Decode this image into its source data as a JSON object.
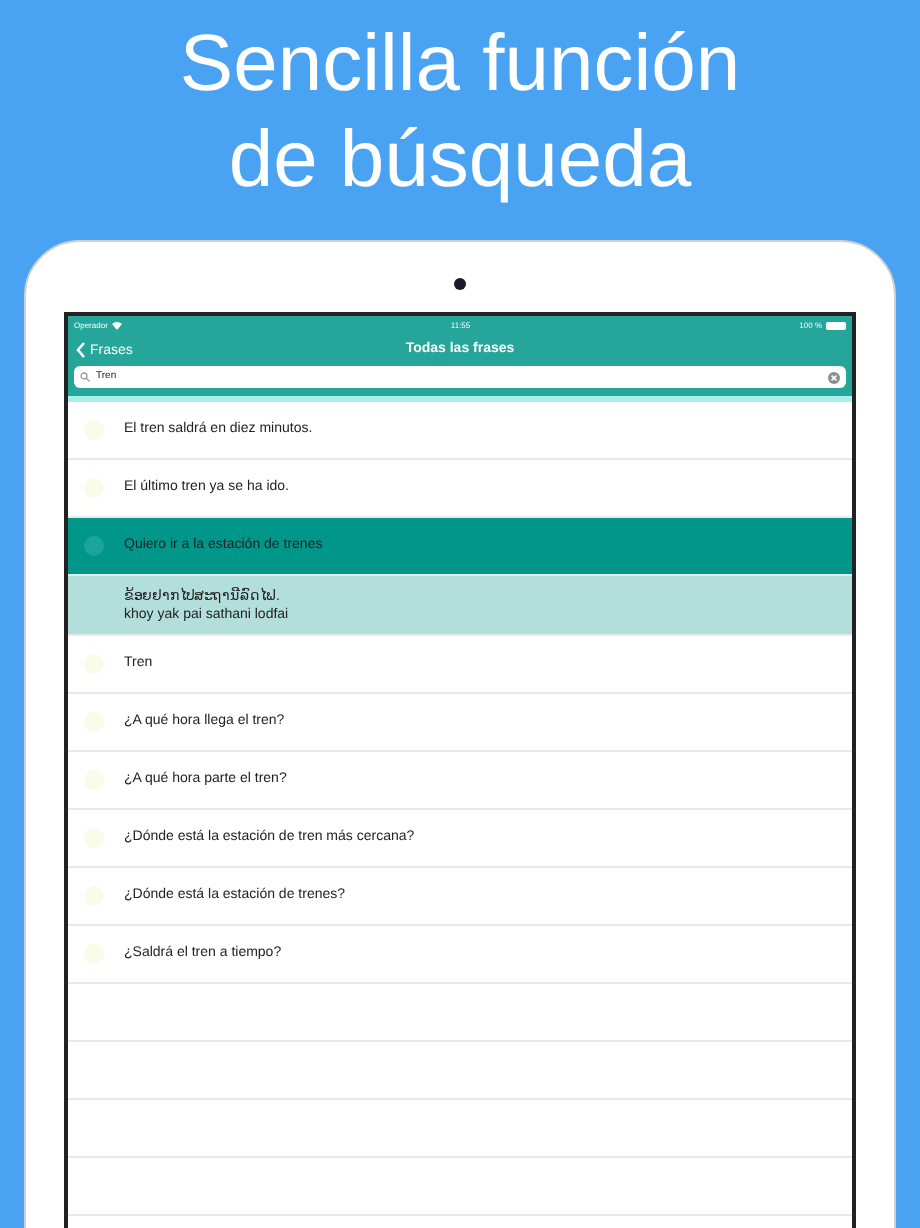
{
  "headline": [
    "Sencilla función",
    "de búsqueda"
  ],
  "status_bar": {
    "carrier": "Operador",
    "time": "11:55",
    "battery": "100 %"
  },
  "nav": {
    "back": "Frases",
    "title": "Todas las frases"
  },
  "search": {
    "value": "Tren"
  },
  "rows": [
    {
      "kind": "phrase",
      "text": "El tren saldrá en diez minutos.",
      "selected": false
    },
    {
      "kind": "phrase",
      "text": "El último tren ya se ha ido.",
      "selected": false
    },
    {
      "kind": "phrase",
      "text": "Quiero ir a la estación de trenes",
      "selected": true
    },
    {
      "kind": "translation",
      "text": "ຂ້ອຍຢາກໄປສະຖານີລົດໄຟ.",
      "romanized": "khoy yak pai sathani lodfai"
    },
    {
      "kind": "phrase",
      "text": "Tren",
      "selected": false
    },
    {
      "kind": "phrase",
      "text": "¿A qué hora llega el tren?",
      "selected": false
    },
    {
      "kind": "phrase",
      "text": "¿A qué hora parte el tren?",
      "selected": false
    },
    {
      "kind": "phrase",
      "text": "¿Dónde está la estación de tren más cercana?",
      "selected": false
    },
    {
      "kind": "phrase",
      "text": "¿Dónde está la estación de trenes?",
      "selected": false
    },
    {
      "kind": "phrase",
      "text": "¿Saldrá el tren a tiempo?",
      "selected": false
    }
  ]
}
